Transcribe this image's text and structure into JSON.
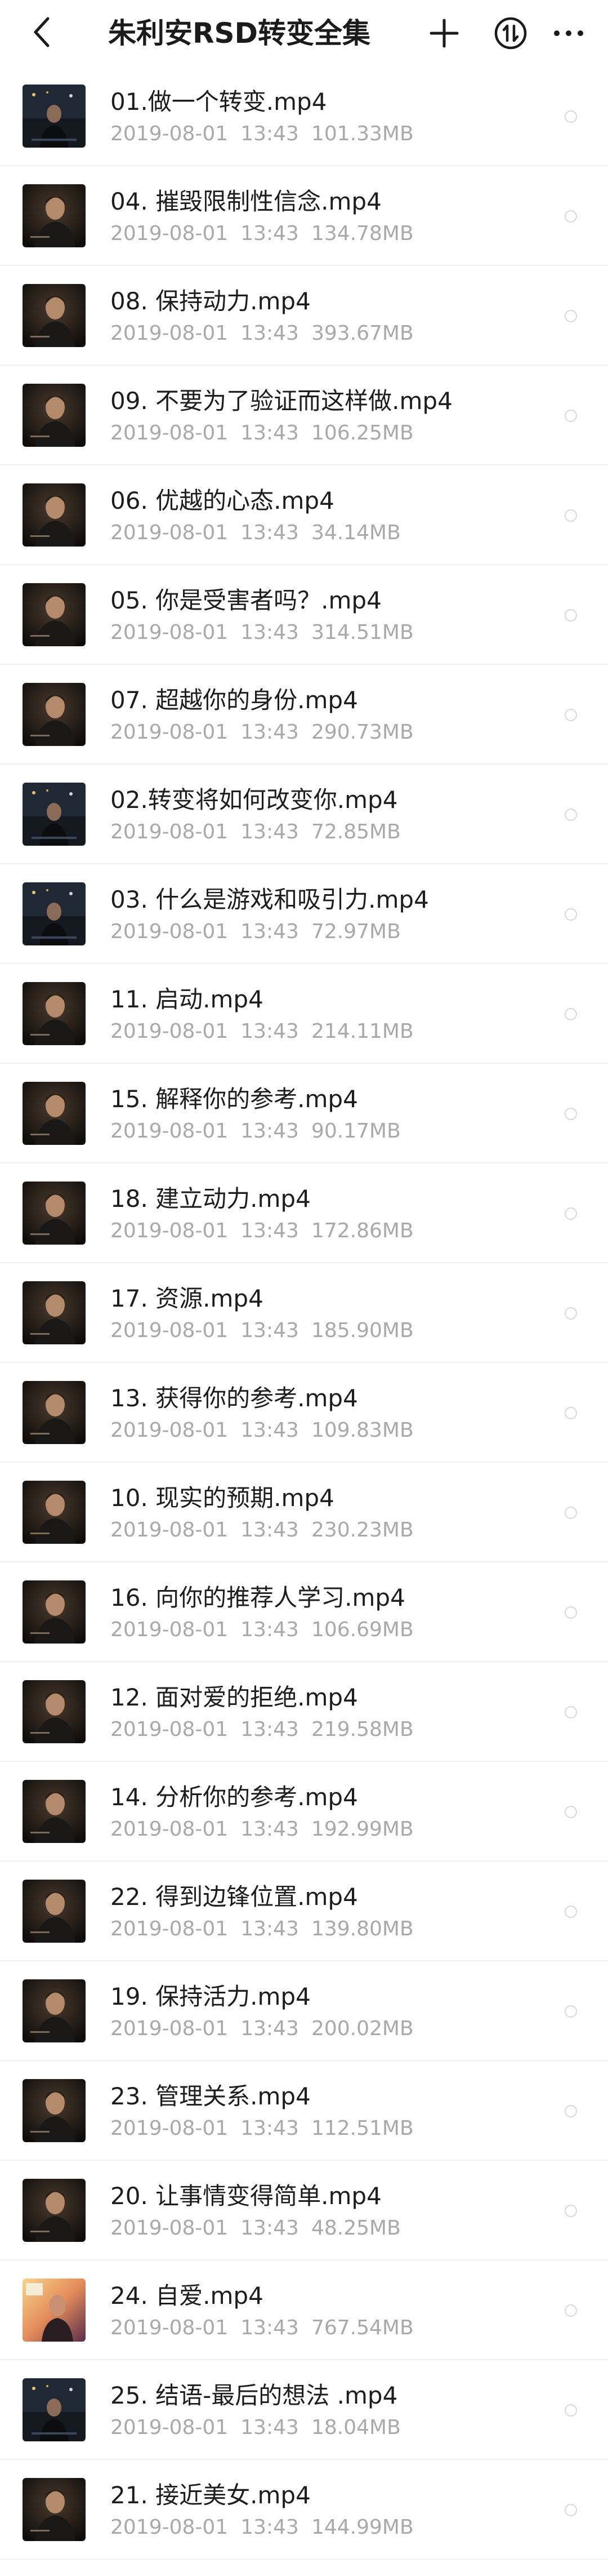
{
  "header": {
    "title": "朱利安RSD转变全集",
    "icons": [
      "back-icon",
      "plus-icon",
      "sort-icon",
      "more-icon"
    ]
  },
  "files": [
    {
      "name": "01.做一个转变.mp4",
      "date": "2019-08-01",
      "time": "13:43",
      "size": "101.33MB",
      "thumb": "dark-stage"
    },
    {
      "name": "04. 摧毁限制性信念.mp4",
      "date": "2019-08-01",
      "time": "13:43",
      "size": "134.78MB",
      "thumb": "speaker"
    },
    {
      "name": "08. 保持动力.mp4",
      "date": "2019-08-01",
      "time": "13:43",
      "size": "393.67MB",
      "thumb": "speaker"
    },
    {
      "name": "09. 不要为了验证而这样做.mp4",
      "date": "2019-08-01",
      "time": "13:43",
      "size": "106.25MB",
      "thumb": "speaker"
    },
    {
      "name": "06. 优越的心态.mp4",
      "date": "2019-08-01",
      "time": "13:43",
      "size": "34.14MB",
      "thumb": "speaker"
    },
    {
      "name": "05. 你是受害者吗？.mp4",
      "date": "2019-08-01",
      "time": "13:43",
      "size": "314.51MB",
      "thumb": "speaker"
    },
    {
      "name": "07. 超越你的身份.mp4",
      "date": "2019-08-01",
      "time": "13:43",
      "size": "290.73MB",
      "thumb": "speaker"
    },
    {
      "name": "02.转变将如何改变你.mp4",
      "date": "2019-08-01",
      "time": "13:43",
      "size": "72.85MB",
      "thumb": "dark-stage"
    },
    {
      "name": "03. 什么是游戏和吸引力.mp4",
      "date": "2019-08-01",
      "time": "13:43",
      "size": "72.97MB",
      "thumb": "dark-stage"
    },
    {
      "name": "11. 启动.mp4",
      "date": "2019-08-01",
      "time": "13:43",
      "size": "214.11MB",
      "thumb": "speaker"
    },
    {
      "name": "15. 解释你的参考.mp4",
      "date": "2019-08-01",
      "time": "13:43",
      "size": "90.17MB",
      "thumb": "speaker"
    },
    {
      "name": "18. 建立动力.mp4",
      "date": "2019-08-01",
      "time": "13:43",
      "size": "172.86MB",
      "thumb": "speaker"
    },
    {
      "name": "17. 资源.mp4",
      "date": "2019-08-01",
      "time": "13:43",
      "size": "185.90MB",
      "thumb": "speaker"
    },
    {
      "name": "13. 获得你的参考.mp4",
      "date": "2019-08-01",
      "time": "13:43",
      "size": "109.83MB",
      "thumb": "speaker"
    },
    {
      "name": "10. 现实的预期.mp4",
      "date": "2019-08-01",
      "time": "13:43",
      "size": "230.23MB",
      "thumb": "speaker"
    },
    {
      "name": "16. 向你的推荐人学习.mp4",
      "date": "2019-08-01",
      "time": "13:43",
      "size": "106.69MB",
      "thumb": "speaker"
    },
    {
      "name": "12. 面对爱的拒绝.mp4",
      "date": "2019-08-01",
      "time": "13:43",
      "size": "219.58MB",
      "thumb": "speaker"
    },
    {
      "name": "14. 分析你的参考.mp4",
      "date": "2019-08-01",
      "time": "13:43",
      "size": "192.99MB",
      "thumb": "speaker"
    },
    {
      "name": "22. 得到边锋位置.mp4",
      "date": "2019-08-01",
      "time": "13:43",
      "size": "139.80MB",
      "thumb": "speaker"
    },
    {
      "name": "19. 保持活力.mp4",
      "date": "2019-08-01",
      "time": "13:43",
      "size": "200.02MB",
      "thumb": "speaker"
    },
    {
      "name": "23. 管理关系.mp4",
      "date": "2019-08-01",
      "time": "13:43",
      "size": "112.51MB",
      "thumb": "speaker"
    },
    {
      "name": "20. 让事情变得简单.mp4",
      "date": "2019-08-01",
      "time": "13:43",
      "size": "48.25MB",
      "thumb": "speaker"
    },
    {
      "name": "24. 自爱.mp4",
      "date": "2019-08-01",
      "time": "13:43",
      "size": "767.54MB",
      "thumb": "bright"
    },
    {
      "name": "25. 结语-最后的想法 .mp4",
      "date": "2019-08-01",
      "time": "13:43",
      "size": "18.04MB",
      "thumb": "dark-stage"
    },
    {
      "name": "21. 接近美女.mp4",
      "date": "2019-08-01",
      "time": "13:43",
      "size": "144.99MB",
      "thumb": "speaker"
    }
  ]
}
